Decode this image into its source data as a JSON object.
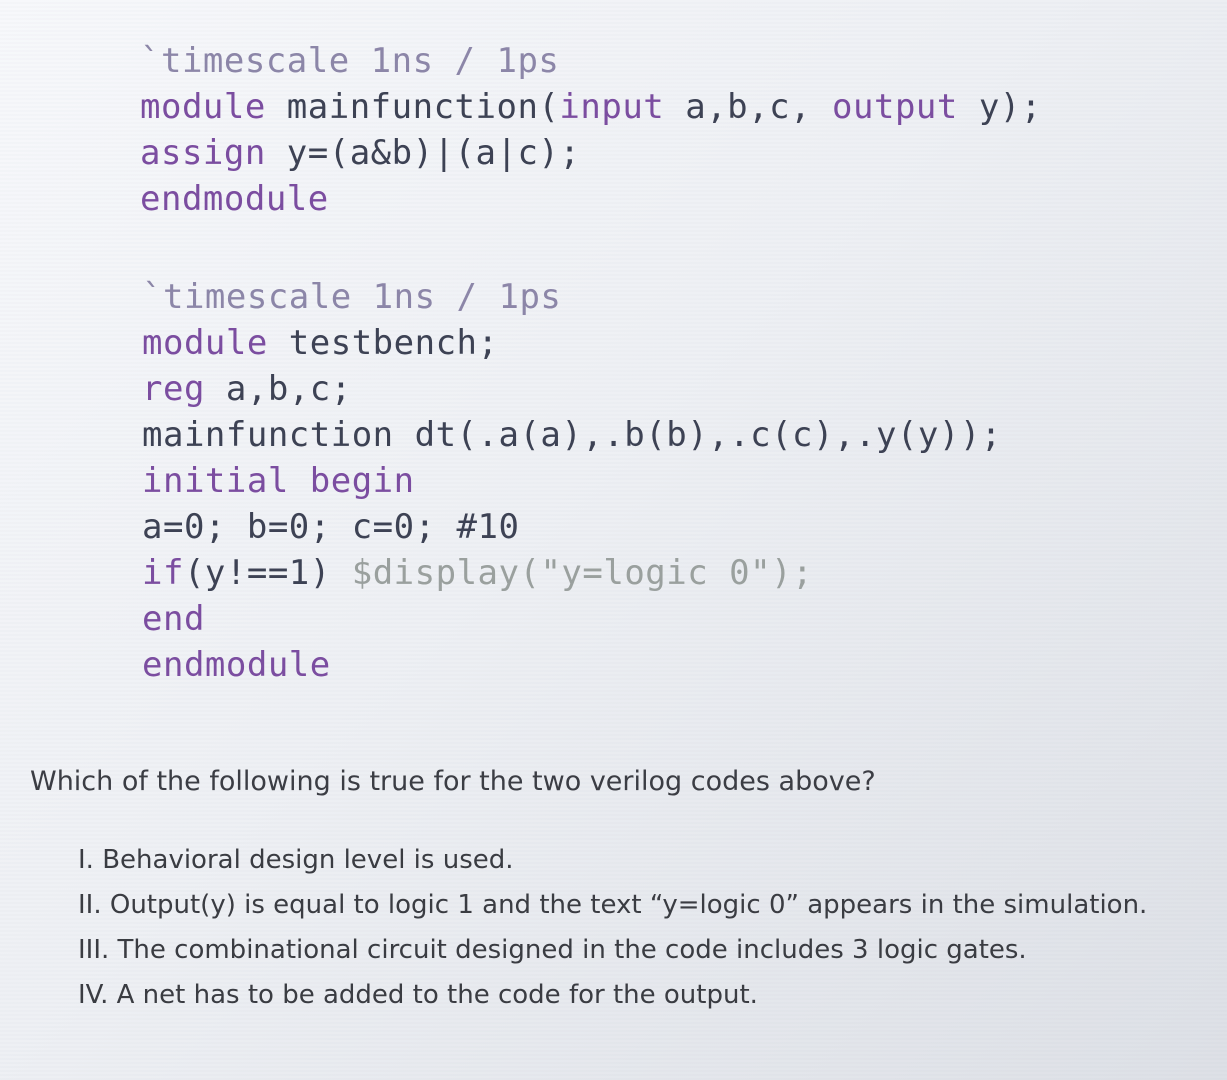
{
  "code_block_1": {
    "lines": [
      [
        {
          "t": "`timescale 1ns / 1ps",
          "c": "dir"
        }
      ],
      [
        {
          "t": "module ",
          "c": "kw"
        },
        {
          "t": "mainfunction(",
          "c": "plain"
        },
        {
          "t": "input ",
          "c": "kw"
        },
        {
          "t": "a,b,c, ",
          "c": "plain"
        },
        {
          "t": "output ",
          "c": "kw"
        },
        {
          "t": "y);",
          "c": "plain"
        }
      ],
      [
        {
          "t": "assign ",
          "c": "kw"
        },
        {
          "t": "y=(a&b)|(a|c);",
          "c": "plain"
        }
      ],
      [
        {
          "t": "endmodule",
          "c": "kw"
        }
      ]
    ]
  },
  "code_block_2": {
    "lines": [
      [
        {
          "t": "`timescale 1ns / 1ps",
          "c": "dir"
        }
      ],
      [
        {
          "t": "module ",
          "c": "kw"
        },
        {
          "t": "testbench;",
          "c": "plain"
        }
      ],
      [
        {
          "t": "reg ",
          "c": "kw"
        },
        {
          "t": "a,b,c;",
          "c": "plain"
        }
      ],
      [
        {
          "t": "mainfunction dt(.a(a),.b(b),.c(c),.y(y));",
          "c": "plain"
        }
      ],
      [
        {
          "t": "initial begin",
          "c": "kw"
        }
      ],
      [
        {
          "t": "a=0; b=0; c=0; #10",
          "c": "plain"
        }
      ],
      [
        {
          "t": "if",
          "c": "kw"
        },
        {
          "t": "(y!==1) ",
          "c": "plain"
        },
        {
          "t": "$display(\"y=logic 0\");",
          "c": "str"
        }
      ],
      [
        {
          "t": "end",
          "c": "kw"
        }
      ],
      [
        {
          "t": "endmodule",
          "c": "kw"
        }
      ]
    ]
  },
  "question": "Which of the following is true for the two verilog codes above?",
  "options": [
    "I. Behavioral design level is used.",
    "II. Output(y) is equal to logic 1 and the text “y=logic 0” appears in the simulation.",
    "III. The combinational circuit designed in the code includes 3 logic gates.",
    "IV. A net has to be added to the code for the output."
  ],
  "colors": {
    "keyword": "#7b4da0",
    "directive": "#8c86a8",
    "string": "#9aa09e",
    "code_text": "#3d4254",
    "body_text": "#3a3c42"
  }
}
